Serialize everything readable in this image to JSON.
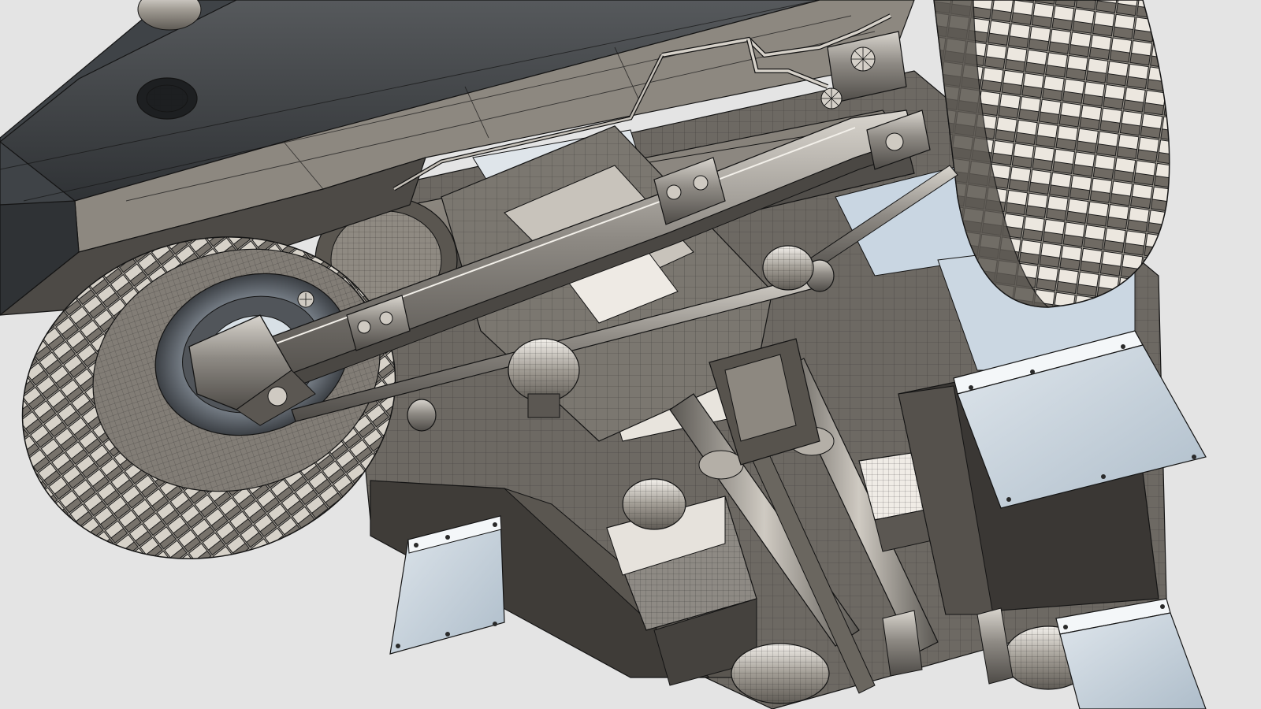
{
  "viewport": {
    "background": "#e4e4e4",
    "render_style": "shaded-with-wireframe-edges",
    "subject": "truck-chassis-underside"
  },
  "colors": {
    "edge": "#141414",
    "body_dark": "#3f4347",
    "body_mid": "#6e6a64",
    "body_light": "#b9b4ab",
    "steel": "#8d8a84",
    "highlight": "#f2efe9",
    "sky_tint": "#c9d6e2",
    "tire": "#a49f97"
  }
}
